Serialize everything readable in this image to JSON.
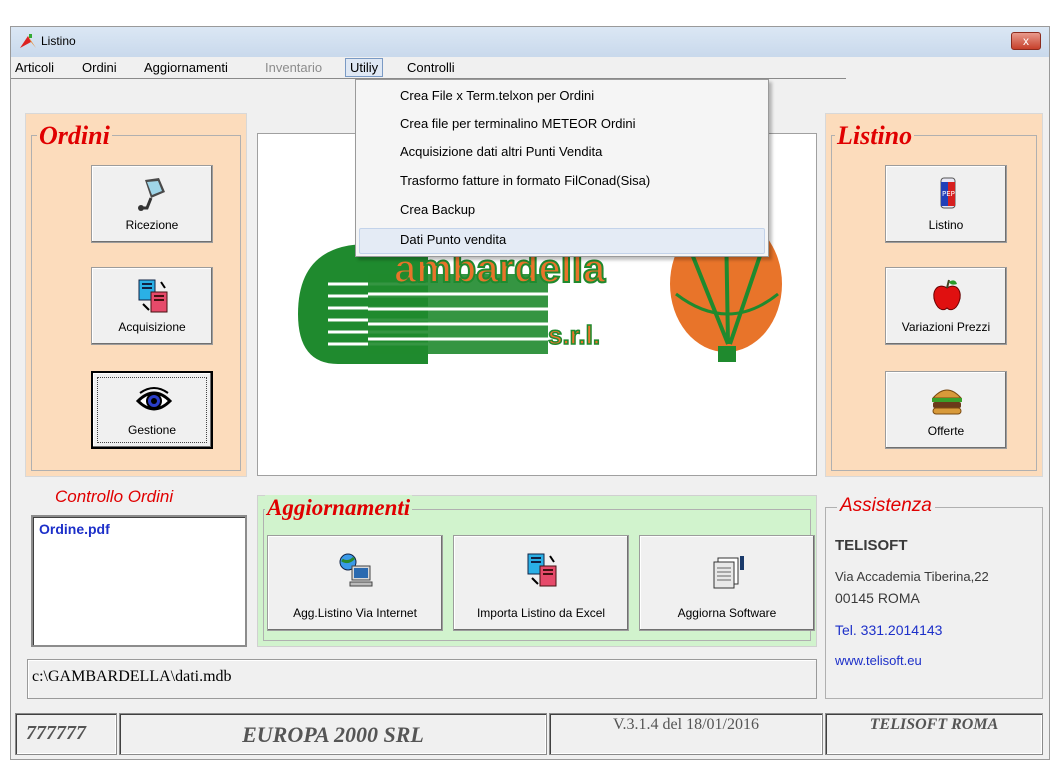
{
  "window": {
    "title": "Listino",
    "close_glyph": "x"
  },
  "menu": {
    "items": [
      {
        "label": "Articoli",
        "state": "normal"
      },
      {
        "label": "Ordini",
        "state": "normal"
      },
      {
        "label": "Aggiornamenti",
        "state": "normal"
      },
      {
        "label": "Inventario",
        "state": "disabled"
      },
      {
        "label": "Utiliy",
        "state": "open"
      },
      {
        "label": "Controlli",
        "state": "normal"
      }
    ],
    "dropdown": [
      "Crea File x Term.telxon per Ordini",
      "Crea file per terminalino METEOR Ordini",
      "Acquisizione dati altri Punti Vendita",
      "Trasformo fatture in formato FilConad(Sisa)",
      "Crea Backup",
      "Dati Punto vendita"
    ],
    "dropdown_highlighted": "Dati Punto vendita"
  },
  "ordini": {
    "title": "Ordini",
    "buttons": [
      {
        "label": "Ricezione",
        "icon": "scanner-icon"
      },
      {
        "label": "Acquisizione",
        "icon": "copy-files-icon"
      },
      {
        "label": "Gestione",
        "icon": "eye-icon"
      }
    ]
  },
  "listino": {
    "title": "Listino",
    "buttons": [
      {
        "label": "Listino",
        "icon": "soda-can-icon"
      },
      {
        "label": "Variazioni Prezzi",
        "icon": "apple-icon"
      },
      {
        "label": "Offerte",
        "icon": "burger-icon"
      }
    ]
  },
  "logo": {
    "text": "ambardella",
    "suffix": "s.r.l."
  },
  "controllo": {
    "title": "Controllo Ordini",
    "items": [
      "Ordine.pdf"
    ]
  },
  "aggiornamenti": {
    "title": "Aggiornamenti",
    "buttons": [
      {
        "label": "Agg.Listino Via Internet",
        "icon": "computer-globe-icon"
      },
      {
        "label": "Importa Listino da Excel",
        "icon": "copy-files-icon"
      },
      {
        "label": "Aggiorna Software",
        "icon": "document-stack-icon"
      }
    ]
  },
  "assistenza": {
    "title": "Assistenza",
    "company": "TELISOFT",
    "address": "Via Accademia Tiberina,22",
    "city": "00145 ROMA",
    "phone": "Tel. 331.2014143",
    "web": "www.telisoft.eu"
  },
  "path": "c:\\GAMBARDELLA\\dati.mdb",
  "status": {
    "code": "777777",
    "company": "EUROPA 2000 SRL",
    "version": "V.3.1.4 del 18/01/2016",
    "vendor": "TELISOFT ROMA"
  },
  "colors": {
    "accent_red": "#e00000",
    "orange_panel": "#fcdcbc",
    "green_panel": "#d1f3cd",
    "logo_green": "#1f8a2e",
    "logo_orange": "#e8742a"
  }
}
